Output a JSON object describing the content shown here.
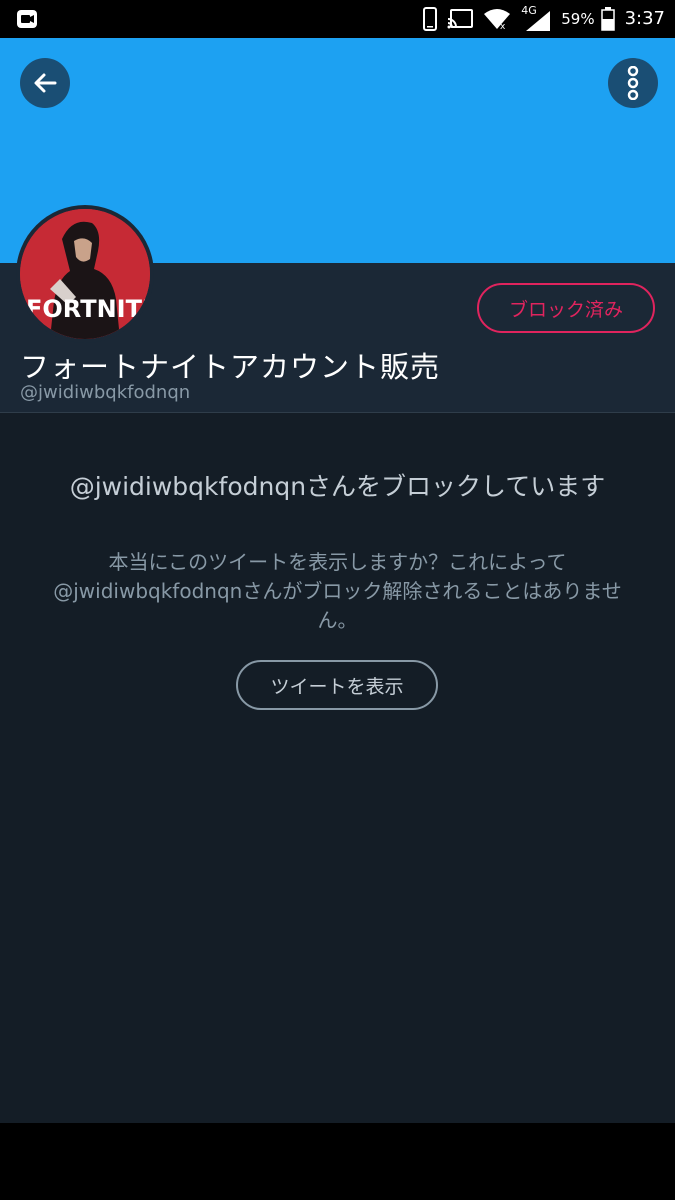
{
  "status_bar": {
    "battery_percent": "59%",
    "time": "3:37",
    "network": "4G",
    "icons": [
      "app-notification-icon",
      "phone-icon",
      "cast-icon",
      "wifi-icon",
      "signal-icon",
      "battery-icon"
    ]
  },
  "header": {
    "back_icon": "arrow-left-icon",
    "more_icon": "more-vertical-icon",
    "banner_color": "#1da1f2"
  },
  "profile": {
    "avatar_text": "FORTNITE",
    "display_name": "フォートナイトアカウント販売",
    "handle": "@jwidiwbqkfodnqn",
    "blocked_button_label": "ブロック済み"
  },
  "notice": {
    "title": "@jwidiwbqkfodnqnさんをブロックしています",
    "body": "本当にこのツイートを表示しますか？これによって@jwidiwbqkfodnqnさんがブロック解除されることはありません。",
    "show_button_label": "ツイートを表示"
  },
  "colors": {
    "accent": "#1da1f2",
    "blocked": "#e0245e",
    "background": "#141d26",
    "panel": "#1b2836"
  }
}
